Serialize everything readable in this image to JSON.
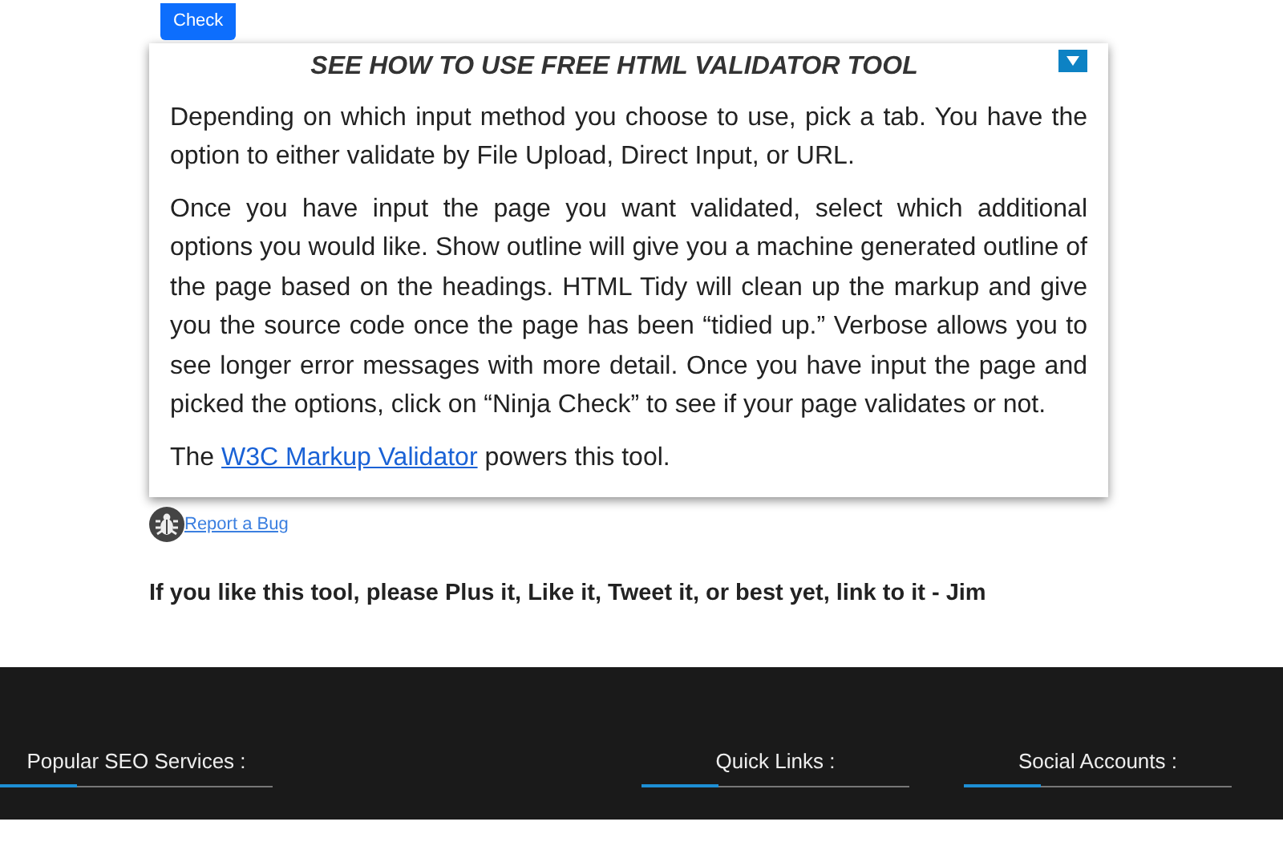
{
  "check_button": "Check",
  "help_panel": {
    "title": "SEE HOW TO USE FREE HTML VALIDATOR TOOL",
    "expanded": true,
    "paragraphs": [
      {
        "text": "Depending on which input method you choose to use, pick a tab. You have the option to either validate by File Upload, Direct Input, or URL."
      },
      {
        "text": "Once you have input the page you want validated, select which additional options you would like. Show outline will give you a machine generated outline of the page based on the headings. HTML Tidy will clean up the markup and give you the source code once the page has been “tidied up.” Verbose allows you to see longer error messages with more detail. Once you have input the page and picked the options, click on “Ninja Check” to see if your page validates or not."
      },
      {
        "before": "The ",
        "link": "W3C Markup Validator",
        "after": " powers this tool."
      }
    ]
  },
  "report_link": "Report a Bug",
  "share_note": "If you like this tool, please Plus it, Like it, Tweet it, or best yet, link to it - Jim",
  "footer": {
    "headings": [
      "Popular SEO Services :",
      "Quick Links :",
      "Social Accounts :"
    ]
  }
}
